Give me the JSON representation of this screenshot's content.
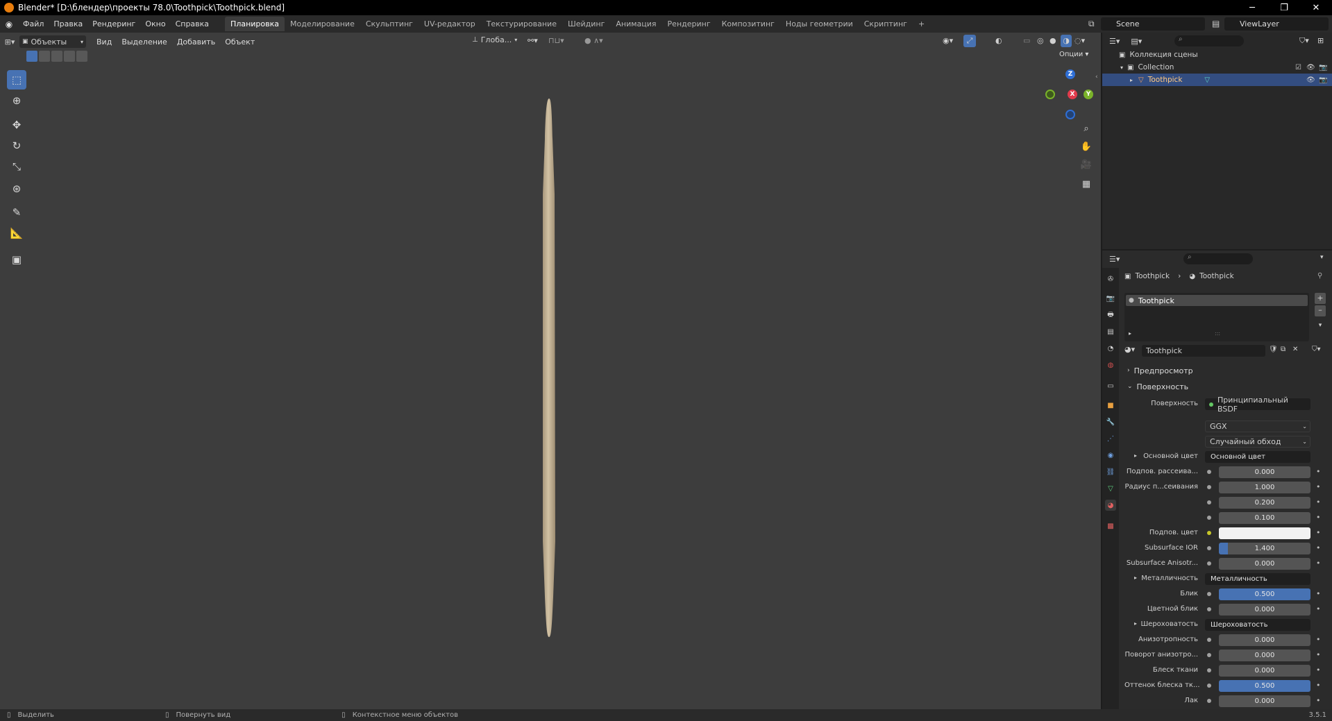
{
  "window": {
    "title": "Blender* [D:\\блендер\\проекты 78.0\\Toothpick\\Toothpick.blend]",
    "minimize": "─",
    "maximize": "❐",
    "close": "✕"
  },
  "menubar": {
    "menus": [
      "Файл",
      "Правка",
      "Рендеринг",
      "Окно",
      "Справка"
    ],
    "workspaces": [
      "Планировка",
      "Моделирование",
      "Скульптинг",
      "UV-редактор",
      "Текстурирование",
      "Шейдинг",
      "Анимация",
      "Рендеринг",
      "Композитинг",
      "Ноды геометрии",
      "Скриптинг"
    ],
    "active_workspace": "Планировка",
    "add_tab": "+",
    "scene": "Scene",
    "view_layer": "ViewLayer"
  },
  "viewport": {
    "mode": "Объекты",
    "menus": [
      "Вид",
      "Выделение",
      "Добавить",
      "Объект"
    ],
    "transform_orientation": "Глоба...",
    "options": "Опции",
    "gizmo_labels": {
      "z": "Z",
      "x": "X",
      "y": "Y"
    },
    "object_color": "#c9b494"
  },
  "outliner": {
    "scene_collection": "Коллекция сцены",
    "collection": "Collection",
    "object": "Toothpick"
  },
  "properties": {
    "breadcrumb_object": "Toothpick",
    "breadcrumb_material": "Toothpick",
    "material_slot": "Toothpick",
    "material_name": "Toothpick",
    "panel_preview": "Предпросмотр",
    "panel_surface": "Поверхность",
    "surface_label": "Поверхность",
    "surface_value": "Принципиальный BSDF",
    "distribution": "GGX",
    "subsurface_method": "Случайный обход",
    "rows": [
      {
        "label": "Основной цвет",
        "value": "Основной цвет",
        "kind": "link"
      },
      {
        "label": "Подпов. рассеива...",
        "value": "0.000",
        "kind": "num"
      },
      {
        "label": "Радиус п...сеивания",
        "value": "1.000",
        "kind": "num"
      },
      {
        "label": "",
        "value": "0.200",
        "kind": "num"
      },
      {
        "label": "",
        "value": "0.100",
        "kind": "num"
      },
      {
        "label": "Подпов. цвет",
        "value": "",
        "kind": "color"
      },
      {
        "label": "Subsurface IOR",
        "value": "1.400",
        "kind": "num"
      },
      {
        "label": "Subsurface Anisotr...",
        "value": "0.000",
        "kind": "num"
      },
      {
        "label": "Металличность",
        "value": "Металличность",
        "kind": "link"
      },
      {
        "label": "Блик",
        "value": "0.500",
        "kind": "blue"
      },
      {
        "label": "Цветной блик",
        "value": "0.000",
        "kind": "num"
      },
      {
        "label": "Шероховатость",
        "value": "Шероховатость",
        "kind": "link"
      },
      {
        "label": "Анизотропность",
        "value": "0.000",
        "kind": "num"
      },
      {
        "label": "Поворот анизотро...",
        "value": "0.000",
        "kind": "num"
      },
      {
        "label": "Блеск ткани",
        "value": "0.000",
        "kind": "num"
      },
      {
        "label": "Оттенок блеска тк...",
        "value": "0.500",
        "kind": "blue"
      },
      {
        "label": "Лак",
        "value": "0.000",
        "kind": "num"
      }
    ]
  },
  "statusbar": {
    "select": "Выделить",
    "rotate": "Повернуть вид",
    "context_menu": "Контекстное меню объектов",
    "version": "3.5.1"
  }
}
